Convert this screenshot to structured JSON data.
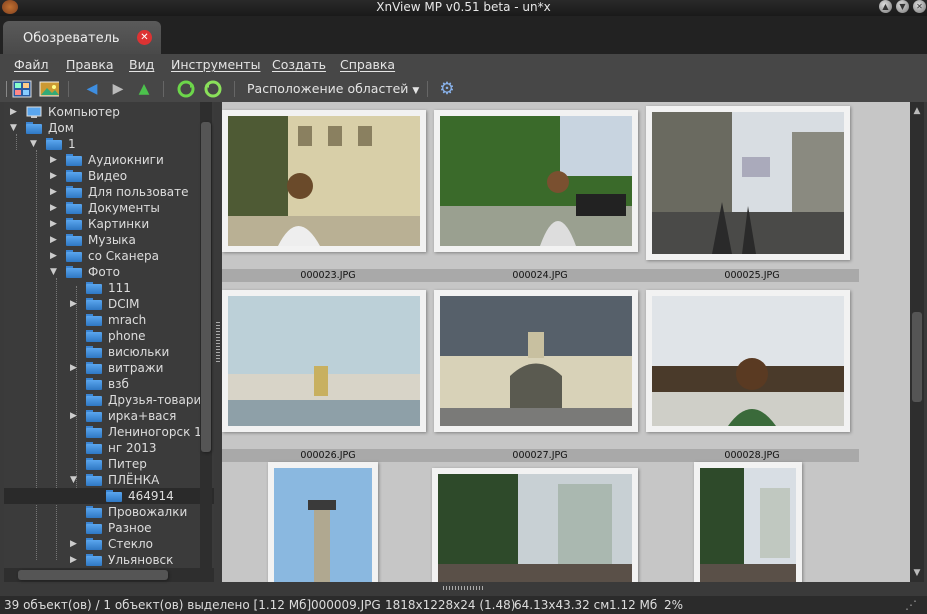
{
  "window": {
    "title": "XnView MP v0.51 beta - un*x"
  },
  "tab": {
    "label": "Обозреватель"
  },
  "menu": [
    "Файл",
    "Правка",
    "Вид",
    "Инструменты",
    "Создать",
    "Справка"
  ],
  "toolbar": {
    "layout_label": "Расположение областей"
  },
  "tree": {
    "computer": "Компьютер",
    "home": "Дом",
    "root": "1",
    "level1": [
      "Аудиокниги",
      "Видео",
      "Для пользовате",
      "Документы",
      "Картинки",
      "Музыка",
      "со Сканера",
      "Фото"
    ],
    "photo_children": [
      "111",
      "DCIM",
      "mrach",
      "phone",
      "висюльки",
      "витражи",
      "взб",
      "Друзья-товари",
      "ирка+вася",
      "Лениногорск 1",
      "нг 2013",
      "Питер",
      "ПЛЁНКА"
    ],
    "film_child": "464914",
    "level1_after": [
      "Провожалки",
      "Разное",
      "Стекло",
      "Ульяновск"
    ]
  },
  "thumbnails": {
    "row1": [
      "000023.JPG",
      "000024.JPG",
      "000025.JPG"
    ],
    "row2": [
      "000026.JPG",
      "000027.JPG",
      "000028.JPG"
    ]
  },
  "status": {
    "count": "39 объект(ов) / 1 объект(ов) выделено [1.12 Мб]",
    "file": "000009.JPG",
    "dims": "1818x1228x24 (1.48)",
    "size_cm": "64.13x43.32 см",
    "filesize": "1.12 Мб",
    "zoom": "2%"
  },
  "colors": {
    "accent_folder": "#3c86d4",
    "close_red": "#dd3333"
  }
}
